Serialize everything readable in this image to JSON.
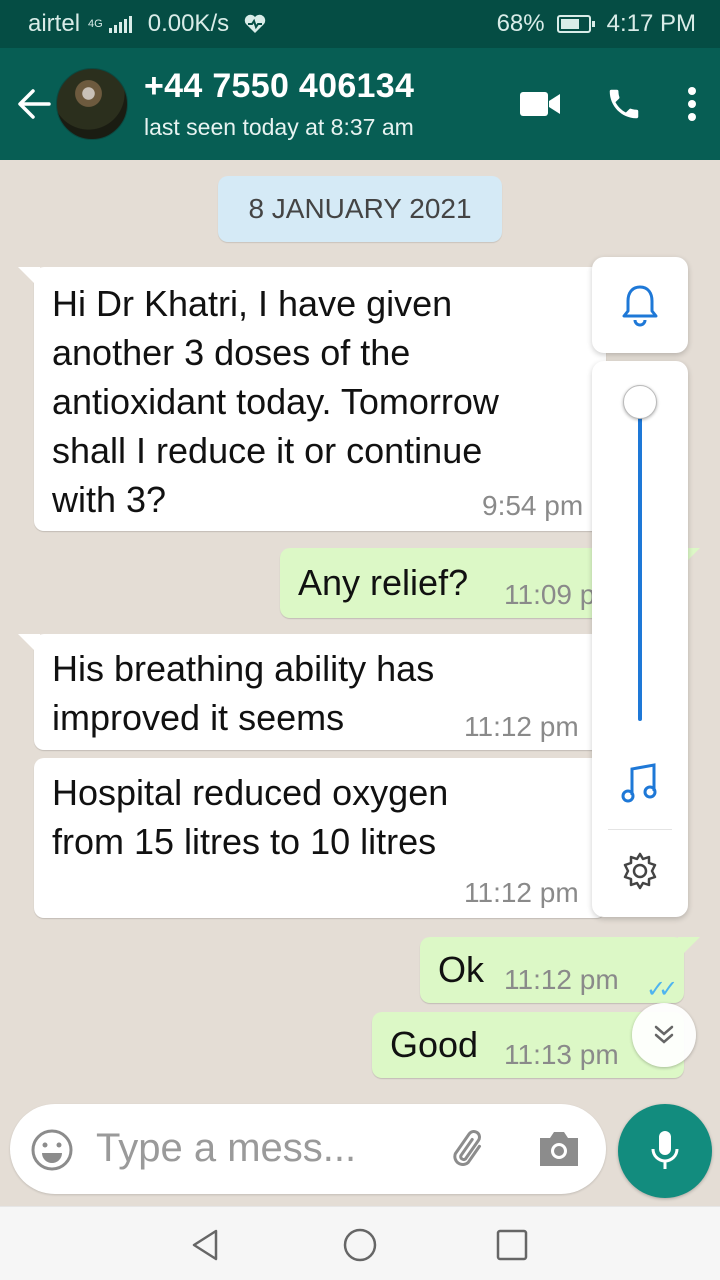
{
  "status_bar": {
    "carrier": "airtel",
    "network": "4G",
    "speed": "0.00K/s",
    "battery": "68%",
    "battery_level": 0.68,
    "time": "4:17 PM"
  },
  "header": {
    "contact_name": "+44 7550 406134",
    "last_seen": "last seen today at 8:37 am",
    "icons": [
      "back-arrow-icon",
      "video-call-icon",
      "phone-call-icon",
      "more-options-icon"
    ]
  },
  "chat": {
    "date_chip": "8 JANUARY 2021",
    "messages": [
      {
        "dir": "in",
        "lines": [
          "Hi Dr Khatri, I have given",
          "another 3 doses of the",
          "antioxidant today. Tomorrow",
          "shall I reduce it or continue",
          "with 3?"
        ],
        "time": "9:54 pm"
      },
      {
        "dir": "out",
        "lines": [
          "Any relief?"
        ],
        "time": "11:09 p"
      },
      {
        "dir": "in",
        "lines": [
          "His breathing ability has",
          "improved it seems"
        ],
        "time": "11:12 pm"
      },
      {
        "dir": "in",
        "lines": [
          "Hospital reduced oxygen",
          "from 15 litres to 10 litres"
        ],
        "time": "11:12 pm"
      },
      {
        "dir": "out",
        "lines": [
          "Ok"
        ],
        "time": "11:12 pm"
      },
      {
        "dir": "out",
        "lines": [
          "Good"
        ],
        "time": "11:13 pm"
      }
    ]
  },
  "volume_panel": {
    "level": 1.0,
    "icons": [
      "bell-icon",
      "music-note-icon",
      "settings-gear-icon"
    ]
  },
  "input": {
    "placeholder": "Type a mess..."
  },
  "colors": {
    "header": "#075e54",
    "status_bar": "#054d44",
    "outgoing_bubble": "#dcf8c6",
    "incoming_bubble": "#ffffff",
    "chat_background": "#e4ddd5",
    "accent": "#128c7e",
    "read_ticks": "#4fb4ef",
    "volume_slider": "#1e78d7"
  }
}
